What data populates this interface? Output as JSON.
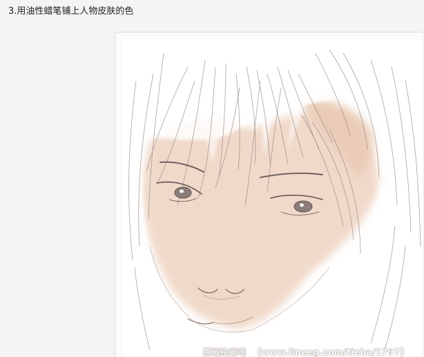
{
  "step": {
    "title": "3.用油性蜡笔铺上人物皮肤的色"
  },
  "artwork": {
    "skin_color": "#efd5c4",
    "line_color": "#7d6f6c",
    "watermark_brand": "原画绘画吧",
    "watermark_url": "【www.lineeg.com/tieba/1797】"
  }
}
